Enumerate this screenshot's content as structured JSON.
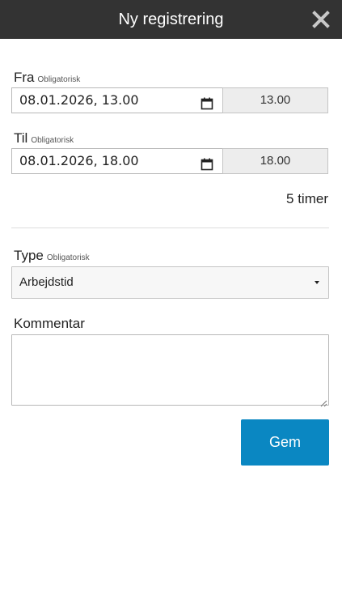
{
  "header": {
    "title": "Ny registrering",
    "close_icon": "close-icon"
  },
  "form": {
    "from": {
      "label": "Fra",
      "required": "Obligatorisk",
      "datetime_value": "08.01.2026, 13.00",
      "time_value": "13.00"
    },
    "to": {
      "label": "Til",
      "required": "Obligatorisk",
      "datetime_value": "08.01.2026, 18.00",
      "time_value": "18.00"
    },
    "duration": "5 timer",
    "type": {
      "label": "Type",
      "required": "Obligatorisk",
      "selected": "Arbejdstid"
    },
    "comment": {
      "label": "Kommentar",
      "value": ""
    },
    "save_label": "Gem"
  },
  "colors": {
    "header_bg": "#333333",
    "accent": "#0a87c2"
  }
}
